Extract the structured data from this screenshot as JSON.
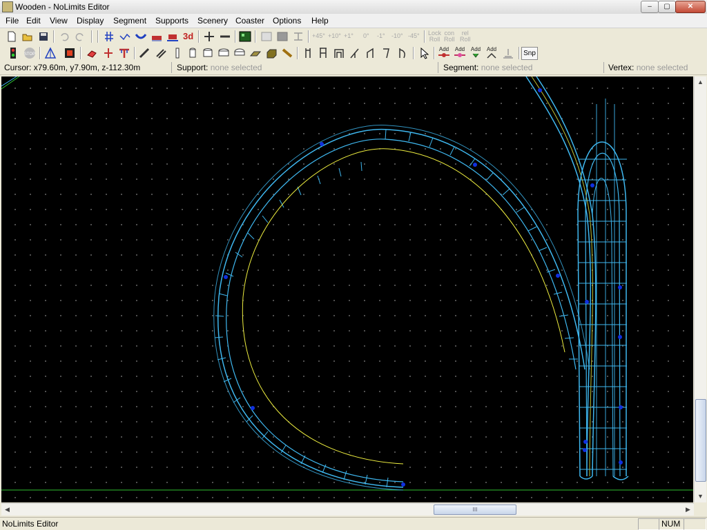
{
  "window": {
    "title": "Wooden - NoLimits Editor",
    "min": "–",
    "max": "▢",
    "close": "✕"
  },
  "menu": [
    "File",
    "Edit",
    "View",
    "Display",
    "Segment",
    "Supports",
    "Scenery",
    "Coaster",
    "Options",
    "Help"
  ],
  "toolbar": {
    "label_3d": "3d",
    "angles": [
      "+45°",
      "+10°",
      "+1°",
      "0°",
      "-1°",
      "-10°",
      "-45°"
    ],
    "lock_roll": [
      "Lock",
      "Roll"
    ],
    "con_roll": [
      "con",
      "Roll"
    ],
    "rel_roll": [
      "rel",
      "Roll"
    ],
    "add_label": "Add",
    "snap": "Snp"
  },
  "info": {
    "cursor_label": "Cursor:",
    "cursor_value": "x79.60m, y7.90m, z-112.30m",
    "support_label": "Support:",
    "support_value": "none selected",
    "segment_label": "Segment:",
    "segment_value": "none selected",
    "vertex_label": "Vertex:",
    "vertex_value": "none selected"
  },
  "scroll": {
    "thumb_grip": "III"
  },
  "status": {
    "text": "NoLimits Editor",
    "num": "NUM"
  },
  "colors": {
    "track": "#3fb8f0",
    "spine": "#f0f040",
    "vertex": "#1030e0",
    "ground": "#30c030"
  }
}
